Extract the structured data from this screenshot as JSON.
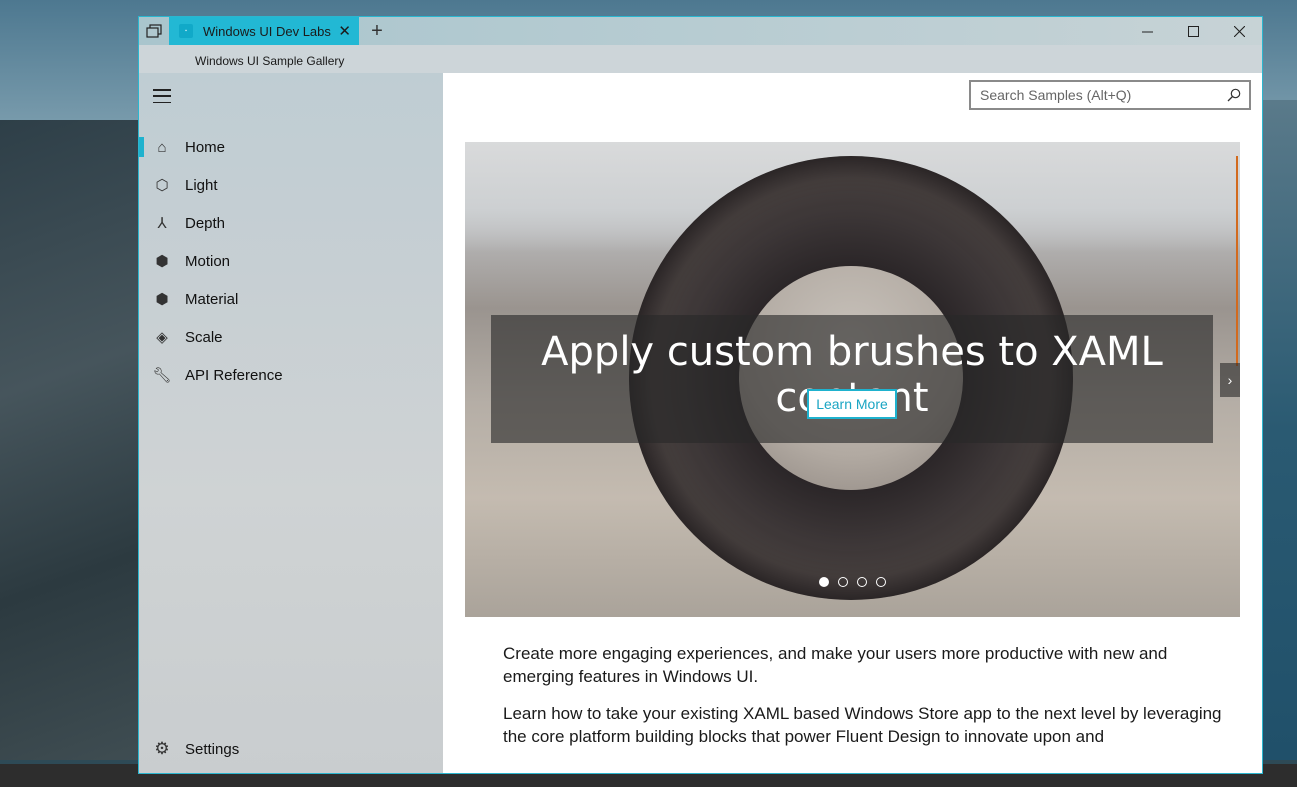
{
  "window": {
    "tab_title": "Windows UI Dev Labs S",
    "app_title": "Windows UI Sample Gallery",
    "accent_color": "#1fb2ce"
  },
  "titlebar": {
    "tab_switcher_icon": "tab-switcher-icon",
    "new_tab_label": "+",
    "minimize_icon": "minimize-icon",
    "maximize_icon": "maximize-icon",
    "close_icon": "close-icon"
  },
  "sidebar": {
    "menu_icon": "hamburger-icon",
    "items": [
      {
        "label": "Home",
        "icon": "home-icon",
        "active": true
      },
      {
        "label": "Light",
        "icon": "light-icon",
        "active": false
      },
      {
        "label": "Depth",
        "icon": "depth-icon",
        "active": false
      },
      {
        "label": "Motion",
        "icon": "motion-icon",
        "active": false
      },
      {
        "label": "Material",
        "icon": "material-icon",
        "active": false
      },
      {
        "label": "Scale",
        "icon": "scale-icon",
        "active": false
      },
      {
        "label": "API Reference",
        "icon": "wrench-icon",
        "active": false
      }
    ],
    "settings_label": "Settings"
  },
  "search": {
    "placeholder": "Search Samples (Alt+Q)"
  },
  "hero": {
    "title": "Apply custom brushes to XAML content",
    "button_label": "Learn More",
    "page_count": 4,
    "current_page": 1
  },
  "body": {
    "paragraph_1": "Create more engaging experiences, and make your users more productive with new and emerging features in Windows UI.",
    "paragraph_2": "Learn how to take your existing XAML based Windows Store app to the next level by leveraging the core platform building blocks that power Fluent Design to innovate upon and"
  }
}
